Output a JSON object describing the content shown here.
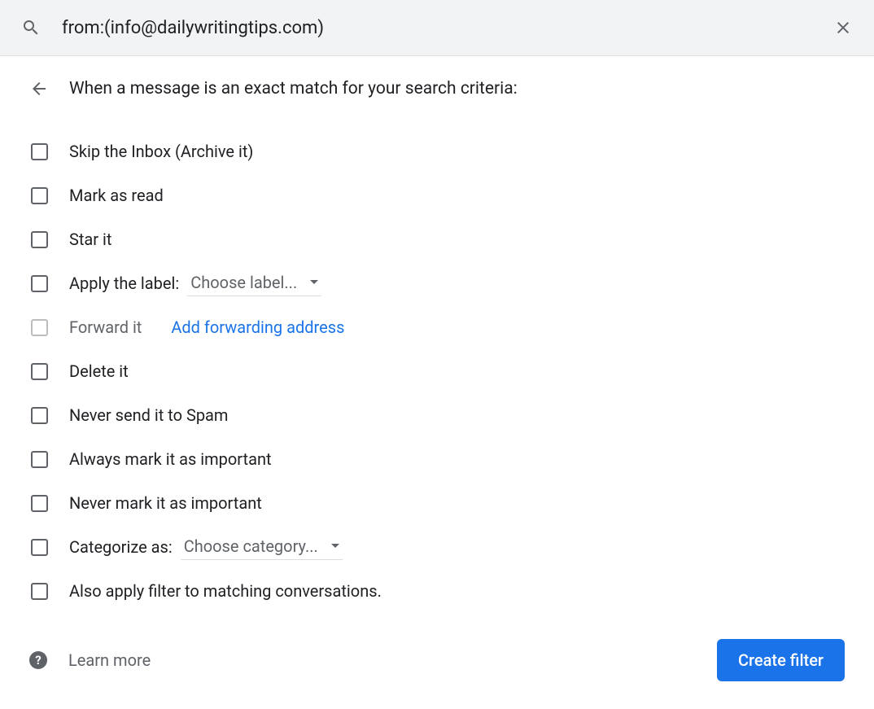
{
  "search": {
    "value": "from:(info@dailywritingtips.com)"
  },
  "header": {
    "text": "When a message is an exact match for your search criteria:"
  },
  "options": {
    "skip_inbox": "Skip the Inbox (Archive it)",
    "mark_read": "Mark as read",
    "star_it": "Star it",
    "apply_label": "Apply the label:",
    "apply_label_dropdown": "Choose label...",
    "forward_it": "Forward it",
    "forward_link": "Add forwarding address",
    "delete_it": "Delete it",
    "never_spam": "Never send it to Spam",
    "always_important": "Always mark it as important",
    "never_important": "Never mark it as important",
    "categorize_as": "Categorize as:",
    "categorize_dropdown": "Choose category...",
    "also_apply": "Also apply filter to matching conversations."
  },
  "footer": {
    "learn_more": "Learn more",
    "create_filter": "Create filter"
  }
}
